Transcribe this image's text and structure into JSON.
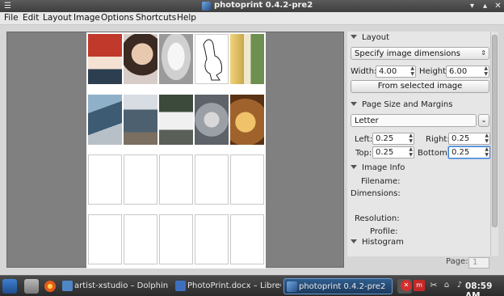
{
  "window": {
    "title": "photoprint 0.4.2-pre2"
  },
  "menu": [
    "File",
    "Edit",
    "Layout",
    "Image",
    "Options",
    "Shortcuts",
    "Help"
  ],
  "layout_section": {
    "header": "Layout",
    "mode": "Specify image dimensions",
    "width_label": "Width:",
    "width_value": "4.00",
    "height_label": "Height:",
    "height_value": "6.00",
    "from_image_button": "From selected image"
  },
  "page_section": {
    "header": "Page Size and Margins",
    "paper": "Letter",
    "left_label": "Left:",
    "left_value": "0.25",
    "right_label": "Right:",
    "right_value": "0.25",
    "top_label": "Top:",
    "top_value": "0.25",
    "bottom_label": "Bottom:",
    "bottom_value": "0.25"
  },
  "image_info": {
    "header": "Image Info",
    "filename_label": "Filename:",
    "dimensions_label": "Dimensions:",
    "resolution_label": "Resolution:",
    "profile_label": "Profile:"
  },
  "histogram": {
    "header": "Histogram"
  },
  "pagination": {
    "label": "Page:",
    "value": "1"
  },
  "taskbar": {
    "tasks": [
      "artist-xstudio – Dolphin",
      "PhotoPrint.docx – LibreO",
      "photoprint 0.4.2-pre2"
    ],
    "clock": "08:59 AM"
  },
  "colors": {
    "accent": "#3a7fd5",
    "titlebar": "#4a4a4a",
    "preview_bg": "#808080"
  }
}
